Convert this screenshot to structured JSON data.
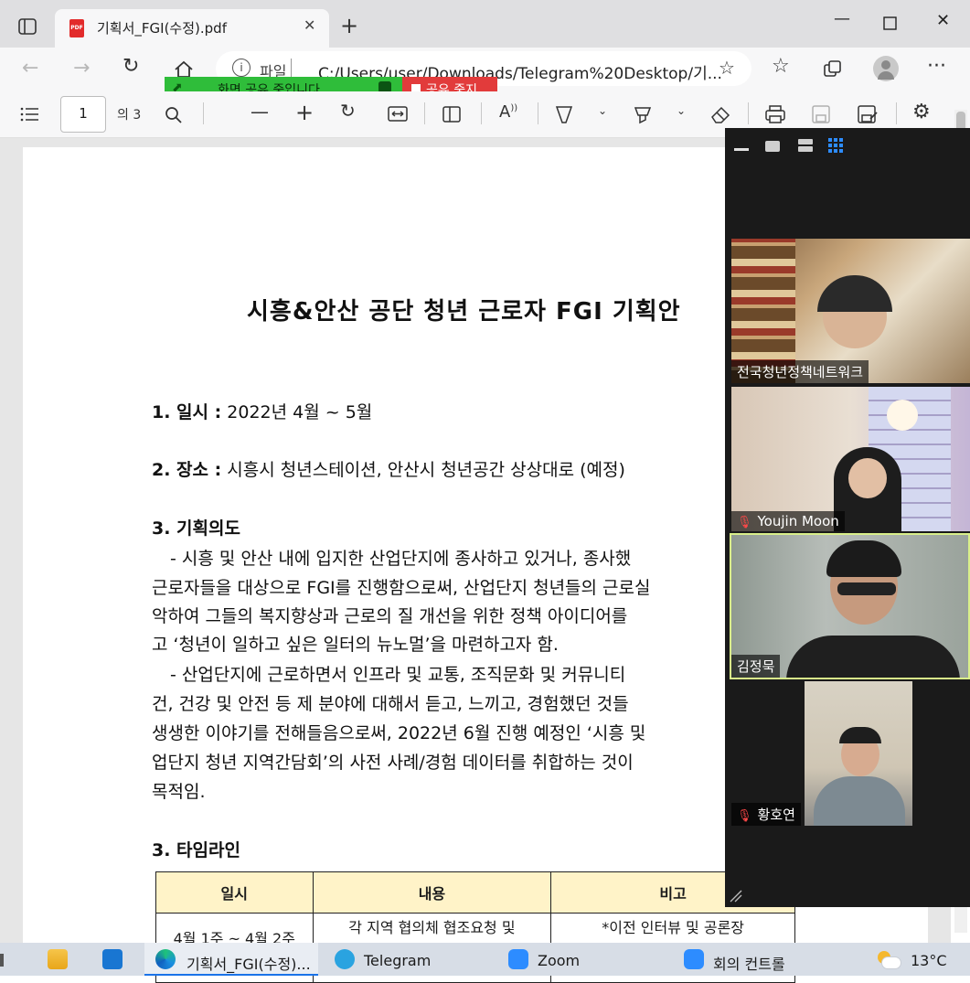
{
  "browser": {
    "tab_title": "기획서_FGI(수정).pdf",
    "pdf_badge": "PDF",
    "address_label": "파일",
    "address_url": "C:/Users/user/Downloads/Telegram%20Desktop/기..."
  },
  "screen_share": {
    "status_text": "화면 공유 중입니다",
    "stop_label": "공유 중지"
  },
  "pdf_toolbar": {
    "page_current": "1",
    "page_total": "의 3"
  },
  "document": {
    "title": "시흥&안산 공단 청년 근로자 FGI 기획안",
    "item1_label": "1. 일시 :",
    "item1_value": " 2022년 4월 ~ 5월",
    "item2_label": "2. 장소 :",
    "item2_value": " 시흥시 청년스테이션, 안산시 청년공간 상상대로 (예정)",
    "item3_heading": "3. 기획의도",
    "paragraph_lines": [
      "- 시흥 및 안산 내에 입지한 산업단지에 종사하고 있거나, 종사했",
      "근로자들을 대상으로 FGI를 진행함으로써, 산업단지 청년들의 근로실",
      "악하여 그들의 복지향상과 근로의 질 개선을 위한 정책 아이디어를",
      "고 ‘청년이 일하고 싶은 일터의 뉴노멀’을 마련하고자 함.",
      "- 산업단지에 근로하면서 인프라 및 교통, 조직문화 및 커뮤니티",
      "건, 건강 및 안전 등 제 분야에 대해서 듣고, 느끼고, 경험했던 것들",
      "생생한 이야기를 전해들음으로써, 2022년 6월 진행 예정인 ‘시흥 및",
      "업단지 청년 지역간담회’의 사전 사례/경험 데이터를 취합하는 것이",
      "목적임."
    ],
    "item4_heading": "3. 타임라인",
    "table_headers": [
      "일시",
      "내용",
      "비고"
    ],
    "table_row1": [
      "4월 1주 ~ 4월 2주",
      "각 지역 협의체 협조요청 및",
      "*이전 인터뷰 및 공론장"
    ]
  },
  "zoom": {
    "participants": [
      {
        "name": "전국청년정책네트워크",
        "muted": false
      },
      {
        "name": "Youjin Moon",
        "muted": true
      },
      {
        "name": "김정묵",
        "muted": false
      },
      {
        "name": "황호연",
        "muted": true
      }
    ]
  },
  "taskbar": {
    "edge_label": "기획서_FGI(수정)...",
    "telegram_label": "Telegram",
    "zoom_label": "Zoom",
    "meeting_label": "회의 컨트롤",
    "temperature": "13°C"
  },
  "colors": {
    "share_green": "#2fbd3a",
    "stop_red": "#e23b3b",
    "active_speaker": "#d9ef8a",
    "table_header": "#fff3c8"
  }
}
